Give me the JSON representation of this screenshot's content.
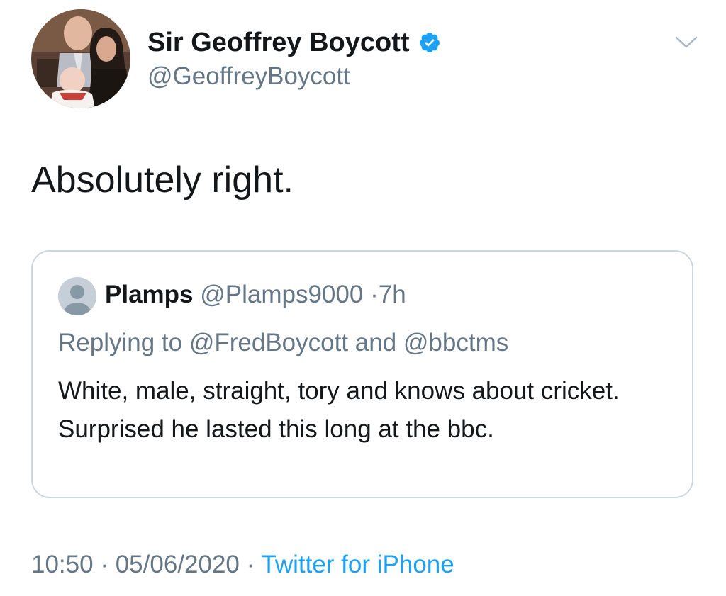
{
  "tweet": {
    "author": {
      "display_name": "Sir Geoffrey Boycott",
      "handle": "@GeoffreyBoycott",
      "verified": true,
      "avatar_icon": "profile-photo"
    },
    "menu_icon": "chevron-down-icon",
    "text": "Absolutely right.",
    "time": "10:50",
    "date": "05/06/2020",
    "separator": "·",
    "source": "Twitter for iPhone"
  },
  "quoted_tweet": {
    "avatar_icon": "default-avatar",
    "display_name": "Plamps",
    "handle": "@Plamps9000",
    "separator": "·",
    "age": "7h",
    "replying_to": "Replying to @FredBoycott and @bbctms",
    "text": "White, male, straight, tory and knows about cricket. Surprised he lasted this long at the bbc."
  },
  "colors": {
    "text_primary": "#14171a",
    "text_secondary": "#657786",
    "accent": "#1da1f2",
    "border": "#ccd6dd"
  }
}
